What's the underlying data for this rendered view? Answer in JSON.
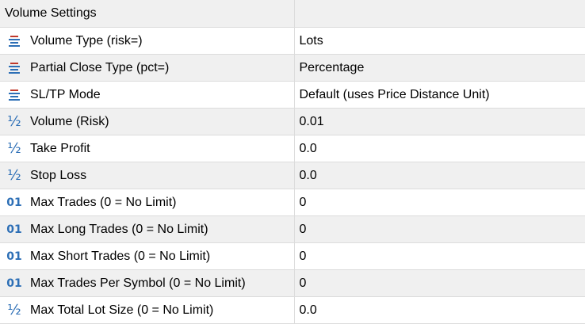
{
  "colors": {
    "enum_top": "#c0392b",
    "enum_lines": "#2d6fb6",
    "numeric_icon": "#2d6fb6",
    "row_alt": "#f0f0f0",
    "grid_line": "#dcdcdc"
  },
  "header": {
    "title": "Volume Settings",
    "value": ""
  },
  "rows": [
    {
      "icon": "enum-list-icon",
      "label": "Volume Type (risk=)",
      "value": "Lots"
    },
    {
      "icon": "enum-list-icon",
      "label": "Partial Close Type (pct=)",
      "value": "Percentage"
    },
    {
      "icon": "enum-list-icon",
      "label": "SL/TP Mode",
      "value": "Default (uses Price Distance Unit)"
    },
    {
      "icon": "fraction-icon",
      "glyph": "½",
      "label": "Volume (Risk)",
      "value": "0.01"
    },
    {
      "icon": "fraction-icon",
      "glyph": "½",
      "label": "Take Profit",
      "value": "0.0"
    },
    {
      "icon": "fraction-icon",
      "glyph": "½",
      "label": "Stop Loss",
      "value": "0.0"
    },
    {
      "icon": "integer-icon",
      "glyph": "01",
      "label": "Max Trades (0 = No Limit)",
      "value": "0"
    },
    {
      "icon": "integer-icon",
      "glyph": "01",
      "label": "Max Long Trades (0 = No Limit)",
      "value": "0"
    },
    {
      "icon": "integer-icon",
      "glyph": "01",
      "label": "Max Short Trades (0 = No Limit)",
      "value": "0"
    },
    {
      "icon": "integer-icon",
      "glyph": "01",
      "label": "Max Trades Per Symbol (0 = No Limit)",
      "value": "0"
    },
    {
      "icon": "fraction-icon",
      "glyph": "½",
      "label": "Max Total Lot Size (0 = No Limit)",
      "value": "0.0"
    }
  ]
}
